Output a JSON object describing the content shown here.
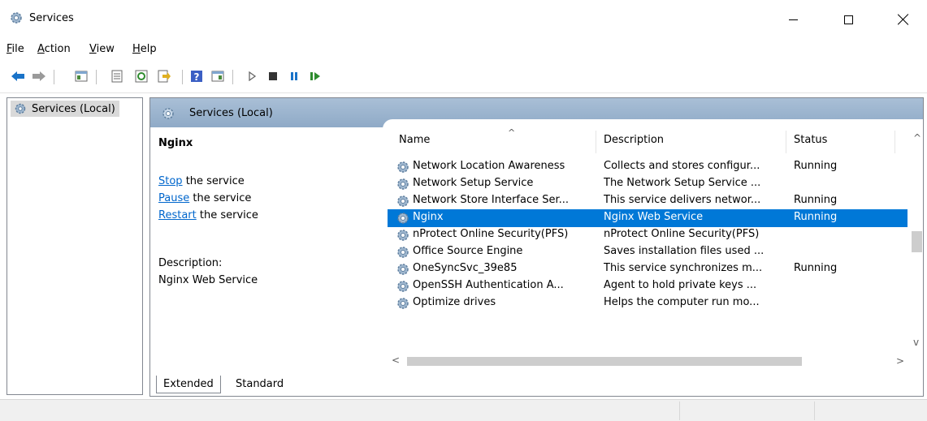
{
  "window": {
    "title": "Services",
    "minimize": "—",
    "maximize": "☐",
    "close": "✕"
  },
  "menu": [
    {
      "mn": "F",
      "rest": "ile"
    },
    {
      "mn": "A",
      "rest": "ction"
    },
    {
      "mn": "V",
      "rest": "iew"
    },
    {
      "mn": "H",
      "rest": "elp"
    }
  ],
  "toolbar_icons": [
    "back-arrow-icon",
    "forward-arrow-icon",
    "show-hide-console-tree-icon",
    "properties-icon",
    "refresh-icon",
    "export-list-icon",
    "help-icon",
    "action-pane-icon",
    "start-service-icon",
    "stop-service-icon",
    "pause-service-icon",
    "restart-service-icon"
  ],
  "tree": {
    "item": "Services (Local)"
  },
  "pane": {
    "title": "Services (Local)",
    "selected_name": "Nginx",
    "actions": [
      {
        "link": "Stop",
        "text": " the service"
      },
      {
        "link": "Pause",
        "text": " the service"
      },
      {
        "link": "Restart",
        "text": " the service"
      }
    ],
    "description_label": "Description:",
    "description_text": "Nginx Web Service"
  },
  "columns": [
    "Name",
    "Description",
    "Status"
  ],
  "rows": [
    {
      "name": "Network Location Awareness",
      "description": "Collects and stores configur...",
      "status": "Running",
      "selected": false
    },
    {
      "name": "Network Setup Service",
      "description": "The Network Setup Service ...",
      "status": "",
      "selected": false
    },
    {
      "name": "Network Store Interface Ser...",
      "description": "This service delivers networ...",
      "status": "Running",
      "selected": false
    },
    {
      "name": "Nginx",
      "description": "Nginx Web Service",
      "status": "Running",
      "selected": true
    },
    {
      "name": "nProtect Online Security(PFS)",
      "description": "nProtect Online Security(PFS)",
      "status": "",
      "selected": false
    },
    {
      "name": "Office  Source Engine",
      "description": "Saves installation files used ...",
      "status": "",
      "selected": false
    },
    {
      "name": "OneSyncSvc_39e85",
      "description": "This service synchronizes m...",
      "status": "Running",
      "selected": false
    },
    {
      "name": "OpenSSH Authentication A...",
      "description": "Agent to hold private keys ...",
      "status": "",
      "selected": false
    },
    {
      "name": "Optimize drives",
      "description": "Helps the computer run mo...",
      "status": "",
      "selected": false
    }
  ],
  "tabs": {
    "extended": "Extended",
    "standard": "Standard"
  },
  "scroll": {
    "up": "^",
    "down": "v",
    "left": "<",
    "right": ">"
  },
  "colors": {
    "selection": "#0078d7",
    "link": "#0066cc",
    "header": "#8faac7"
  }
}
